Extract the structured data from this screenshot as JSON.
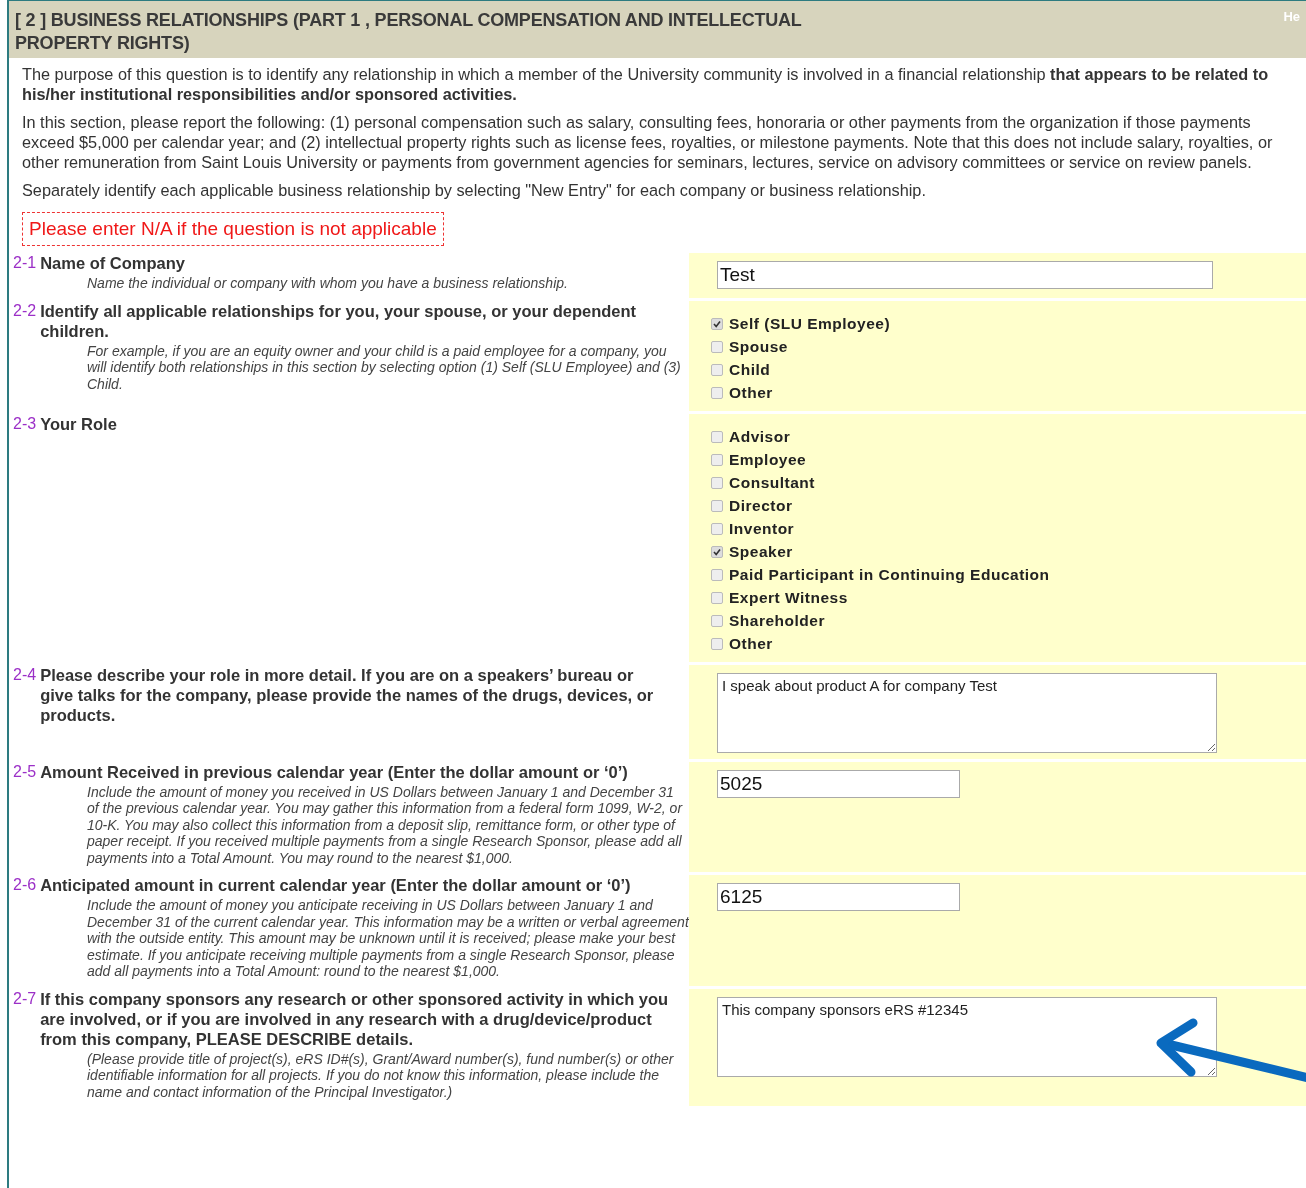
{
  "header": {
    "title": "[ 2 ] BUSINESS RELATIONSHIPS (PART 1 , PERSONAL COMPENSATION AND INTELLECTUAL PROPERTY RIGHTS)",
    "help_link": "He"
  },
  "intro": [
    "The purpose of this question is to identify any relationship in which a member of the University community is involved in a financial relationship **that appears to be related to his/her institutional responsibilities and/or sponsored activities.**",
    "In this section, please report the following: (1) personal compensation such as salary, consulting fees, honoraria or other payments from the organization if those payments exceed $5,000 per calendar year; and (2) intellectual property rights such as license fees, royalties, or milestone payments. Note that this does not include salary, royalties, or other remuneration from Saint Louis University or payments from government agencies for seminars, lectures, service on advisory committees or service on review panels.",
    "Separately identify each applicable business relationship by selecting \"New Entry\" for each company or business relationship."
  ],
  "warning": "Please enter N/A if the question is not applicable",
  "questions": [
    {
      "number": "2-1",
      "title": "Name of Company",
      "hint": "Name the individual or company with whom you have a business relationship.",
      "kind": "text",
      "value": "Test"
    },
    {
      "number": "2-2",
      "title": "Identify all applicable relationships for you, your spouse, or your dependent children.",
      "hint": "For example, if you are an equity owner and your child is a paid employee for a company, you will identify both relationships in this section by selecting option (1) Self (SLU Employee) and (3) Child.",
      "kind": "checkboxes",
      "options": [
        {
          "label": "Self (SLU Employee)",
          "checked": true
        },
        {
          "label": "Spouse",
          "checked": false
        },
        {
          "label": "Child",
          "checked": false
        },
        {
          "label": "Other",
          "checked": false
        }
      ]
    },
    {
      "number": "2-3",
      "title": "Your Role",
      "kind": "checkboxes",
      "options": [
        {
          "label": "Advisor",
          "checked": false
        },
        {
          "label": "Employee",
          "checked": false
        },
        {
          "label": "Consultant",
          "checked": false
        },
        {
          "label": "Director",
          "checked": false
        },
        {
          "label": "Inventor",
          "checked": false
        },
        {
          "label": "Speaker",
          "checked": true
        },
        {
          "label": "Paid Participant in Continuing Education",
          "checked": false
        },
        {
          "label": "Expert Witness",
          "checked": false
        },
        {
          "label": "Shareholder",
          "checked": false
        },
        {
          "label": "Other",
          "checked": false
        }
      ]
    },
    {
      "number": "2-4",
      "title": "Please describe your role in more detail. If you are on a speakers’ bureau or give talks for the company, please provide the names of the drugs, devices, or products.",
      "kind": "textarea",
      "value": "I speak about product A for company Test"
    },
    {
      "number": "2-5",
      "title": "Amount Received in previous calendar year (Enter the dollar amount or ‘0’)",
      "hint": "Include the amount of money you received in US Dollars between January 1 and December 31 of the previous calendar year. You may gather this information from a federal form 1099, W-2, or 10-K. You may also collect this information from a deposit slip, remittance form, or other type of paper receipt. If you received multiple payments from a single Research Sponsor, please add all payments into a Total Amount. You may round to the nearest $1,000.",
      "kind": "amount",
      "value": "5025"
    },
    {
      "number": "2-6",
      "title": "Anticipated amount in current calendar year (Enter the dollar amount or ‘0’)",
      "hint": "Include the amount of money you anticipate receiving in US Dollars between January 1 and December 31 of the current calendar year. This information may be a written or verbal agreement with the outside entity. This amount may be unknown until it is received; please make your best estimate. If you anticipate receiving multiple payments from a single Research Sponsor, please add all payments into a Total Amount: round to the nearest $1,000.",
      "kind": "amount",
      "value": "6125"
    },
    {
      "number": "2-7",
      "title": "If this company sponsors any research or other sponsored activity in which you are involved, or if you are involved in any research with a drug/device/product from this company, PLEASE DESCRIBE details.",
      "hint": "(Please provide title of project(s), eRS ID#(s), Grant/Award number(s), fund number(s) or other identifiable information for all projects. If you do not know this information, please include the name and contact information of the Principal Investigator.)",
      "kind": "textarea",
      "value": "This company sponsors eRS #12345",
      "annotated": true
    }
  ]
}
